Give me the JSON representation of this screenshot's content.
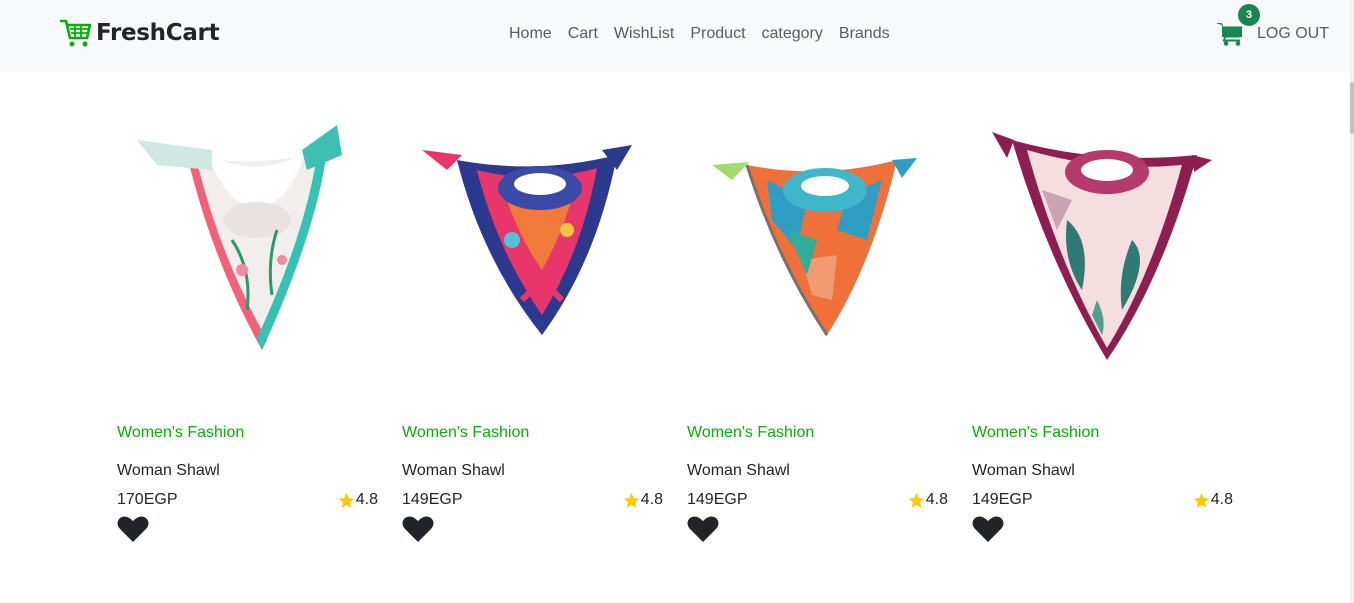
{
  "brand": {
    "name": "FreshCart",
    "icon": "shopping-cart-icon",
    "color": "#0aad0a"
  },
  "nav": {
    "links": [
      "Home",
      "Cart",
      "WishList",
      "Product",
      "category",
      "Brands"
    ],
    "cart_count": "3",
    "logout_label": "LOG OUT"
  },
  "colors": {
    "accent_green": "#0aad0a",
    "badge_green": "#198754",
    "star": "#ffc908",
    "navbar_bg": "#f8f9fa"
  },
  "products": [
    {
      "category": "Women's Fashion",
      "title": "Woman Shawl",
      "price": "170EGP",
      "rating": "4.8"
    },
    {
      "category": "Women's Fashion",
      "title": "Woman Shawl",
      "price": "149EGP",
      "rating": "4.8"
    },
    {
      "category": "Women's Fashion",
      "title": "Woman Shawl",
      "price": "149EGP",
      "rating": "4.8"
    },
    {
      "category": "Women's Fashion",
      "title": "Woman Shawl",
      "price": "149EGP",
      "rating": "4.8"
    }
  ]
}
